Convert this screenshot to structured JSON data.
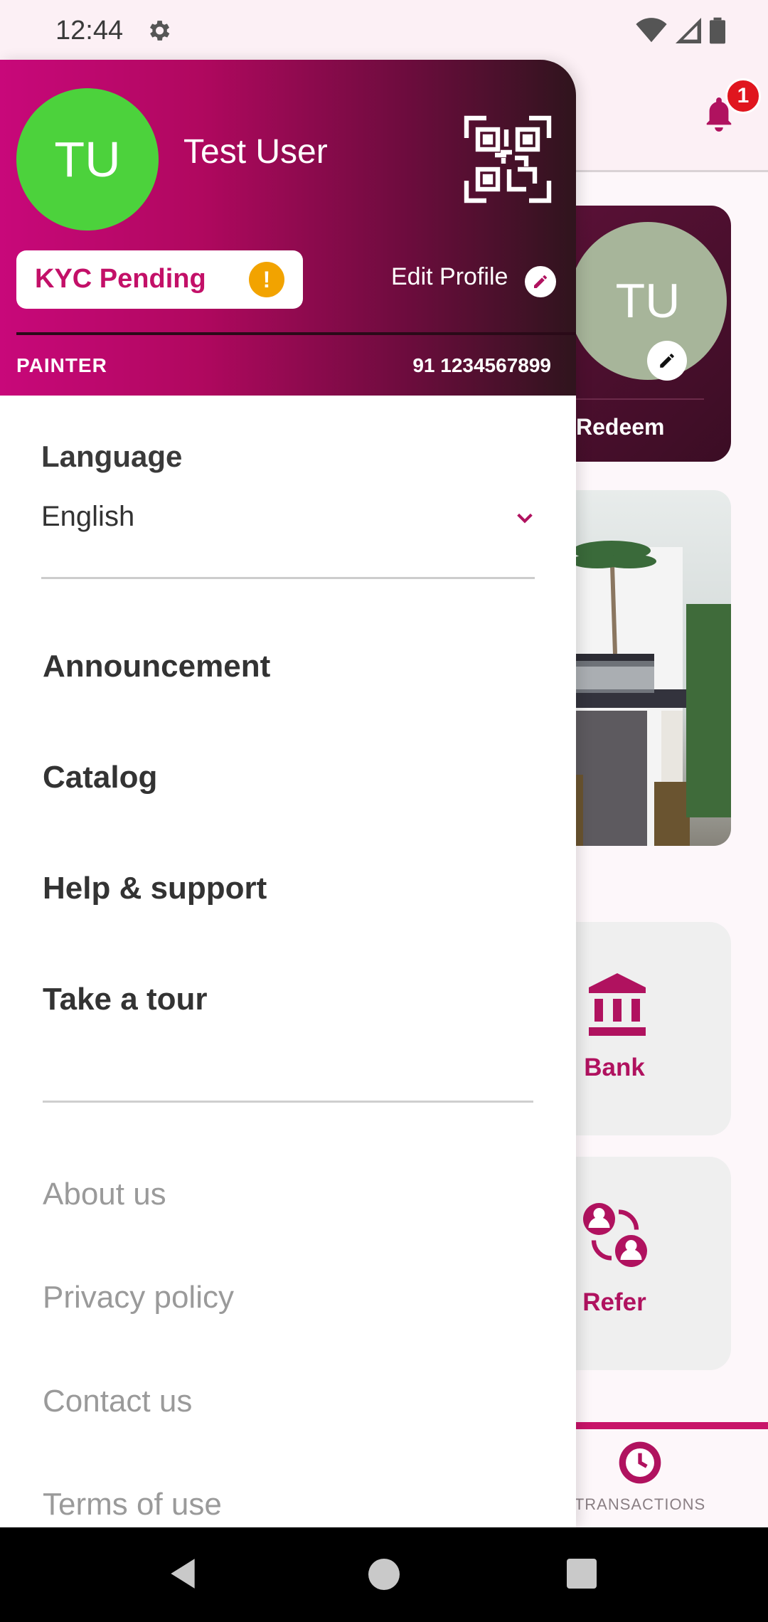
{
  "status_bar": {
    "time": "12:44",
    "icons": [
      "gear-icon",
      "wifi-icon",
      "signal-icon",
      "battery-icon"
    ]
  },
  "background": {
    "notification_count": "1",
    "profile_card": {
      "initials": "TU",
      "action": "Redeem"
    },
    "tiles": [
      {
        "label": "Bank",
        "icon": "bank-icon"
      },
      {
        "label": "Refer",
        "icon": "refer-icon"
      }
    ],
    "bottom_nav": {
      "active_label": "TRANSACTIONS"
    }
  },
  "drawer": {
    "avatar_initials": "TU",
    "user_name": "Test User",
    "kyc_status": "KYC Pending",
    "edit_profile": "Edit Profile",
    "role": "PAINTER",
    "phone": "91 1234567899",
    "language": {
      "label": "Language",
      "value": "English"
    },
    "menu": [
      "Announcement",
      "Catalog",
      "Help & support",
      "Take a tour"
    ],
    "links": [
      "About us",
      "Privacy policy",
      "Contact us",
      "Terms of use"
    ]
  },
  "colors": {
    "brand": "#c8087a",
    "accent_dark": "#2f141d",
    "avatar": "#4cd23c",
    "warning": "#f2a300",
    "badge": "#e0161e"
  }
}
